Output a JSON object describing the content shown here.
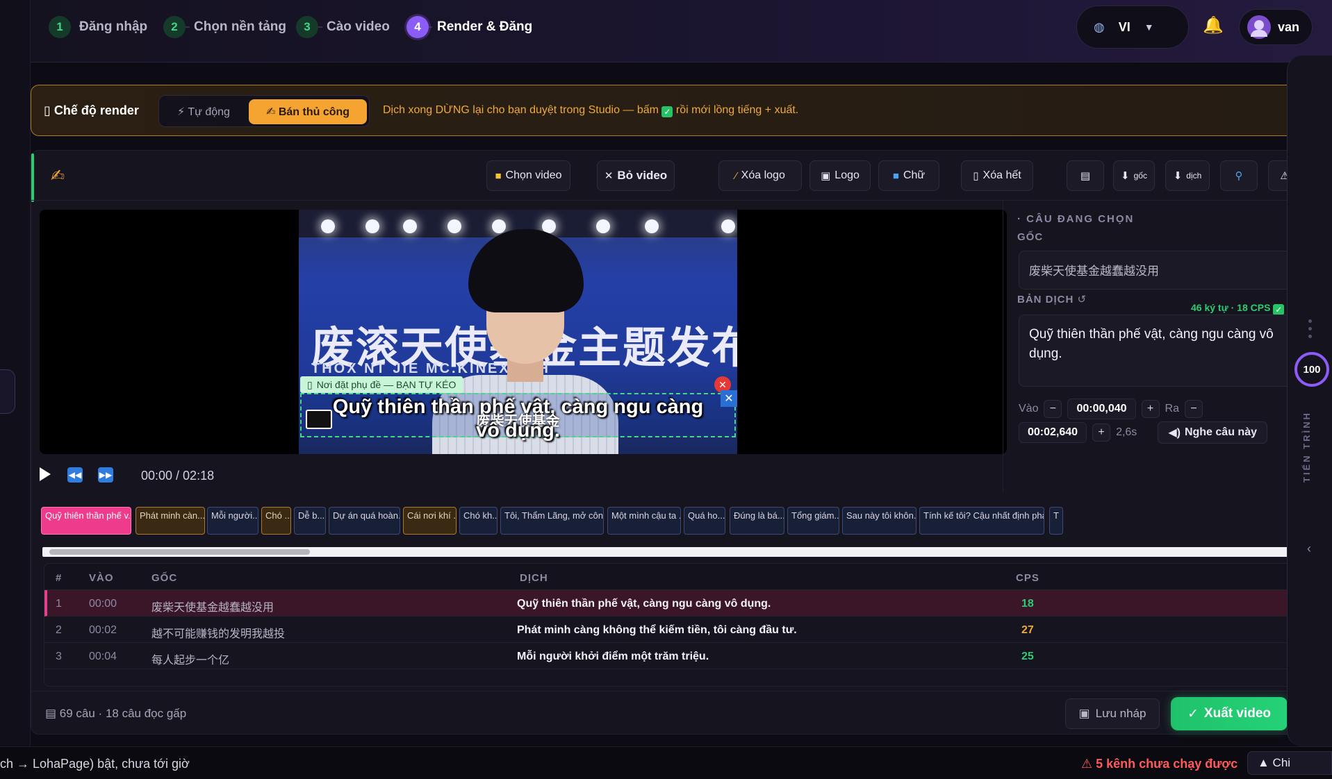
{
  "steps": [
    {
      "num": "1",
      "label": "Đăng nhập"
    },
    {
      "num": "2",
      "label": "Chọn nền tảng"
    },
    {
      "num": "3",
      "label": "Cào video"
    },
    {
      "num": "4",
      "label": "Render & Đăng"
    }
  ],
  "header": {
    "lang_code": "VI",
    "user_name": "van",
    "globe_icon": "globe-icon",
    "bell_icon": "bell-icon"
  },
  "render_mode": {
    "title": "Chế độ render",
    "auto_label": "⚡ Tự động",
    "manual_label": "✍ Bán thủ công",
    "hint_before": "Dịch xong DỪNG lại cho bạn duyệt trong Studio — bấm",
    "hint_after": "rồi mới lồng tiếng + xuất."
  },
  "toolbar": {
    "choose_video": "Chọn video",
    "remove_video": "Bỏ video",
    "remove_logo": "Xóa logo",
    "logo": "Logo",
    "text": "Chữ",
    "clear_all": "Xóa hết",
    "dl_src": "gốc",
    "dl_trans": "dịch"
  },
  "video": {
    "banner_text": "废滚天使基金主题发布",
    "banner_sub": "THOX NT JIE   MC.KINEXEL H",
    "sub_tag": "Nơi đặt phụ đề — BẠN TỰ KÉO",
    "sub_line1": "Quỹ thiên thần phế vật, càng ngu càng",
    "sub_line2": "vô dụng.",
    "sub_zh": "废柴天使基金",
    "time": "00:00 / 02:18"
  },
  "right_panel": {
    "heading": "CÂU ĐANG CHỌN",
    "src_label": "GỐC",
    "src_text": "废柴天使基金越蠢越没用",
    "trans_label": "BẢN DỊCH",
    "cps_info": "46 ký tự · 18 CPS",
    "trans_text": "Quỹ thiên thần phế vật, càng ngu càng vô dụng.",
    "in_label": "Vào",
    "in_time": "00:00,040",
    "out_label": "Ra",
    "out_time": "00:02,640",
    "duration": "2,6s",
    "listen": "Nghe câu này"
  },
  "timeline": [
    {
      "text": "Quỹ thiên thần phế v...",
      "style": "pink"
    },
    {
      "text": "Phát minh càn...",
      "style": "brown"
    },
    {
      "text": "Mỗi người...",
      "style": "blue"
    },
    {
      "text": "Chó ...",
      "style": "brown"
    },
    {
      "text": "Dễ b...",
      "style": "blue"
    },
    {
      "text": "Dự án quá hoàn...",
      "style": "blue"
    },
    {
      "text": "Cái nơi khí ...",
      "style": "brown"
    },
    {
      "text": "Chó kh...",
      "style": "blue"
    },
    {
      "text": "Tôi, Thẩm Lãng, mở côn...",
      "style": "blue"
    },
    {
      "text": "Một mình cậu ta ...",
      "style": "blue"
    },
    {
      "text": "Quá ho...",
      "style": "blue"
    },
    {
      "text": "Đúng là bá...",
      "style": "blue"
    },
    {
      "text": "Tổng giám...",
      "style": "blue"
    },
    {
      "text": "Sau này tôi khôn...",
      "style": "blue"
    },
    {
      "text": "Tính kế tôi? Cậu nhất định phả",
      "style": "blue"
    },
    {
      "text": "T",
      "style": "blue"
    }
  ],
  "table": {
    "headers": {
      "num": "#",
      "in": "VÀO",
      "src": "GỐC",
      "trans": "DỊCH",
      "cps": "CPS"
    },
    "rows": [
      {
        "num": "1",
        "in": "00:00",
        "src": "废柴天使基金越蠢越没用",
        "trans": "Quỹ thiên thần phế vật, càng ngu càng vô dụng.",
        "cps": "18",
        "cps_color": "#2ecc71"
      },
      {
        "num": "2",
        "in": "00:02",
        "src": "越不可能赚钱的发明我越投",
        "trans": "Phát minh càng không thể kiếm tiền, tôi càng đầu tư.",
        "cps": "27",
        "cps_color": "#f0a93a"
      },
      {
        "num": "3",
        "in": "00:04",
        "src": "每人起步一个亿",
        "trans": "Mỗi người khởi điểm một trăm triệu.",
        "cps": "25",
        "cps_color": "#2ecc71"
      }
    ]
  },
  "footer": {
    "info": "69 câu · 18 câu đọc gấp",
    "save": "Lưu nháp",
    "export": "Xuất video"
  },
  "progress": {
    "value": "100",
    "label": "TIẾN TRÌNH"
  },
  "statusbar": {
    "left": "ch → LohaPage) bật, chưa tới giờ",
    "warn": "⚠ 5 kênh chưa chạy được",
    "btn": "▲ Chi"
  },
  "colors": {
    "accent_purple": "#8b5cf6",
    "accent_green": "#2ecc71",
    "accent_orange": "#f6a431",
    "selected_row": "#e6408b"
  }
}
